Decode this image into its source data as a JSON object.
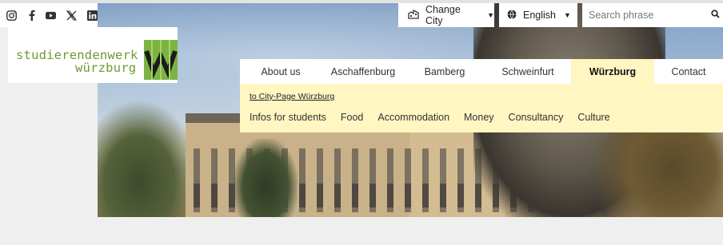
{
  "social": {
    "icons": [
      "instagram-icon",
      "facebook-icon",
      "youtube-icon",
      "x-icon",
      "linkedin-icon"
    ]
  },
  "logo": {
    "line1": "studierendenwerk",
    "line2": "würzburg",
    "mark_color": "#7cb342",
    "text_color": "#6c9b2f"
  },
  "header": {
    "city_label": "Change City",
    "language_label": "English",
    "search_placeholder": "Search phrase"
  },
  "nav": {
    "items": [
      {
        "label": "About us"
      },
      {
        "label": "Aschaffenburg"
      },
      {
        "label": "Bamberg"
      },
      {
        "label": "Schweinfurt"
      },
      {
        "label": "Würzburg"
      },
      {
        "label": "Contact"
      }
    ],
    "active": "Würzburg",
    "active_bg": "#fff6c2"
  },
  "submenu": {
    "city_link": "to City-Page Würzburg",
    "items": [
      {
        "label": "Infos for students"
      },
      {
        "label": "Food"
      },
      {
        "label": "Accommodation"
      },
      {
        "label": "Money"
      },
      {
        "label": "Consultancy"
      },
      {
        "label": "Culture"
      }
    ]
  }
}
